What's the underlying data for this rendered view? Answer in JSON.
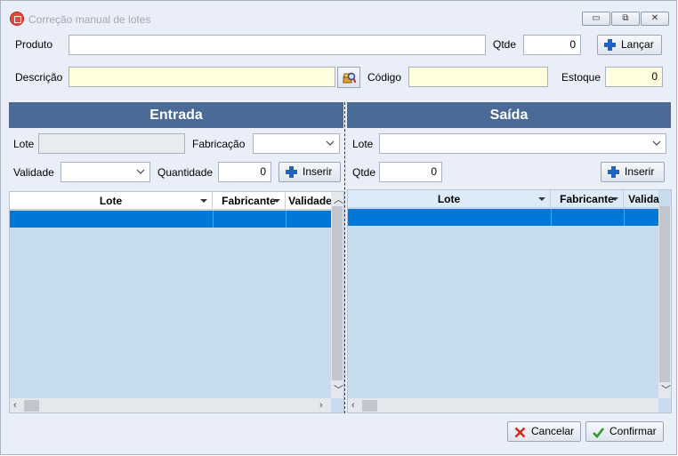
{
  "window": {
    "title": "Correção manual de lotes",
    "minimize_glyph": "▭",
    "maximize_glyph": "⧉",
    "close_glyph": "✕",
    "icon": "app-icon"
  },
  "header": {
    "produto_label": "Produto",
    "produto_value": "",
    "qtde_label": "Qtde",
    "qtde_value": "0",
    "lancar_label": "Lançar",
    "descricao_label": "Descrição",
    "descricao_value": "",
    "codigo_label": "Código",
    "codigo_value": "",
    "estoque_label": "Estoque",
    "estoque_value": "0"
  },
  "entrada": {
    "title": "Entrada",
    "lote_label": "Lote",
    "lote_value": "",
    "fabricacao_label": "Fabricação",
    "fabricacao_value": "",
    "validade_label": "Validade",
    "validade_value": "",
    "quantidade_label": "Quantidade",
    "quantidade_value": "0",
    "inserir_label": "Inserir",
    "columns": [
      "Lote",
      "Fabricante",
      "Validade"
    ]
  },
  "saida": {
    "title": "Saída",
    "lote_label": "Lote",
    "lote_value": "",
    "qtde_label": "Qtde",
    "qtde_value": "0",
    "inserir_label": "Inserir",
    "columns": [
      "Lote",
      "Fabricante",
      "Valida"
    ]
  },
  "footer": {
    "cancelar_label": "Cancelar",
    "confirmar_label": "Confirmar"
  },
  "colors": {
    "section_header": "#4c6a96",
    "selection": "#0078d7",
    "grid_background": "#c8dcf0",
    "required_field": "#ffffe0",
    "window_background": "#e9eef9"
  }
}
